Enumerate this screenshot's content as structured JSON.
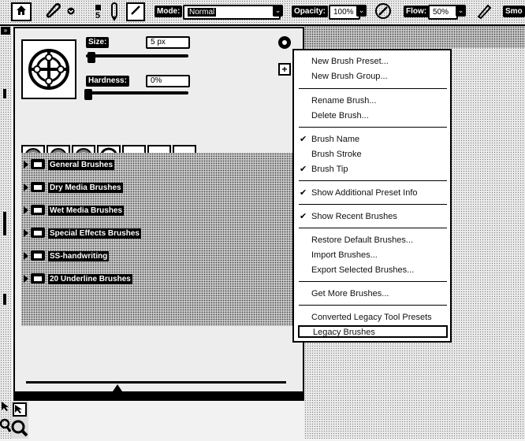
{
  "options_bar": {
    "brush_size_number": "5",
    "mode_label": "Mode:",
    "mode_value": "Normal",
    "opacity_label": "Opacity:",
    "opacity_value": "100%",
    "flow_label": "Flow:",
    "flow_value": "50%",
    "smoothing_label": "Smo"
  },
  "brush_panel": {
    "size_label": "Size:",
    "size_value": "5 px",
    "size_level": 0.03,
    "hardness_label": "Hardness:",
    "hardness_value": "0%",
    "hardness_level": 0.0,
    "folders": [
      {
        "label": "General Brushes"
      },
      {
        "label": "Dry Media Brushes"
      },
      {
        "label": "Wet Media Brushes"
      },
      {
        "label": "Special Effects Brushes"
      },
      {
        "label": "SS-handwriting"
      },
      {
        "label": "20 Underline Brushes"
      }
    ]
  },
  "menu": {
    "items": {
      "new_preset": "New Brush Preset...",
      "new_group": "New Brush Group...",
      "rename": "Rename Brush...",
      "delete": "Delete Brush...",
      "brush_name": "Brush Name",
      "brush_stroke": "Brush Stroke",
      "brush_tip": "Brush Tip",
      "show_additional": "Show Additional Preset Info",
      "show_recent": "Show Recent Brushes",
      "restore": "Restore Default Brushes...",
      "import": "Import Brushes...",
      "export": "Export Selected Brushes...",
      "get_more": "Get More Brushes...",
      "converted": "Converted Legacy Tool Presets",
      "legacy": "Legacy Brushes"
    },
    "checked": [
      "brush_name",
      "brush_tip",
      "show_additional",
      "show_recent"
    ],
    "check_glyph": "✔"
  }
}
